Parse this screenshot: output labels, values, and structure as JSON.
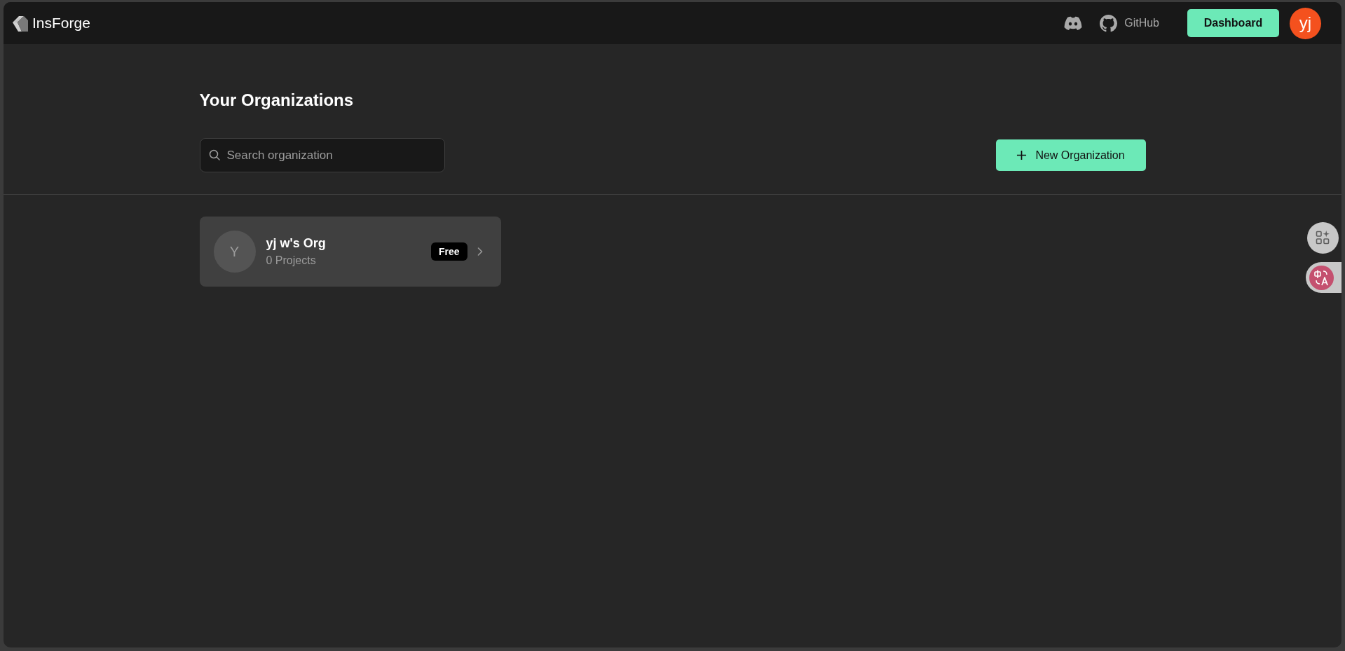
{
  "header": {
    "logo": "InsForge",
    "github_link": "GitHub",
    "dashboard_button": "Dashboard",
    "avatar": "yj"
  },
  "page": {
    "title": "Your Organizations",
    "search": {
      "placeholder": "Search organization"
    },
    "new_button": "New Organization"
  },
  "organizations": [
    {
      "initial": "Y",
      "name": "yj w's Org",
      "projects": "0 Projects",
      "plan": "Free"
    }
  ]
}
